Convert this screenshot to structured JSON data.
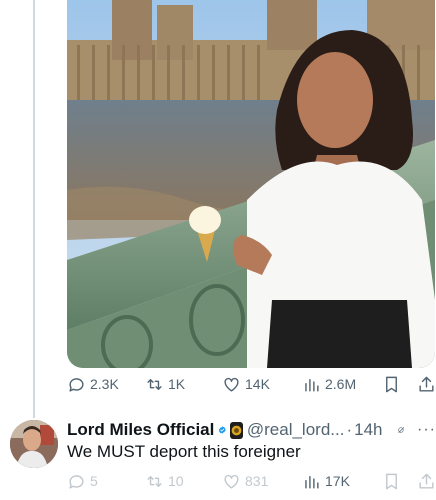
{
  "post": {
    "actions": {
      "replies": "2.3K",
      "reposts": "1K",
      "likes": "14K",
      "views": "2.6M"
    },
    "photo_icons": [
      "bar-chart-icon",
      "bookmark-icon",
      "share-icon"
    ]
  },
  "reply": {
    "name": "Lord Miles Official",
    "handle": "@real_lord...",
    "separator": "·",
    "time": "14h",
    "more": "···",
    "text": "We MUST deport this foreigner",
    "actions": {
      "replies": "5",
      "reposts": "10",
      "likes": "831",
      "views": "17K"
    }
  },
  "colors": {
    "text": "#0f1419",
    "muted": "#536471",
    "verified": "#1d9bf0",
    "thread_line": "#cfd9de"
  }
}
